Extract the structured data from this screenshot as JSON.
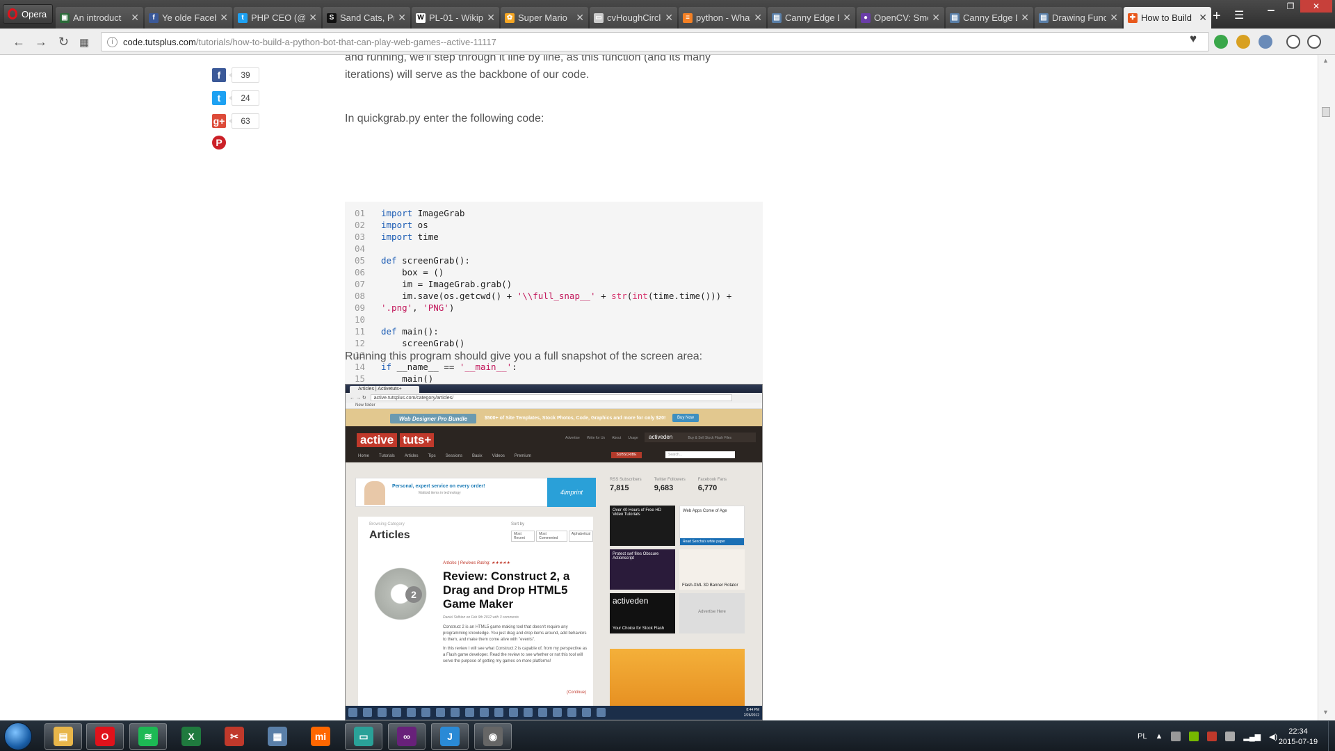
{
  "browser": {
    "menu_label": "Opera",
    "tabs": [
      {
        "title": "An introduct",
        "fav_color": "#2c6b3a",
        "glyph": "▣",
        "active": false
      },
      {
        "title": "Ye olde Faceb",
        "fav_color": "#3b5998",
        "glyph": "f",
        "active": false
      },
      {
        "title": "PHP CEO (@PH",
        "fav_color": "#1da1f2",
        "glyph": "t",
        "active": false
      },
      {
        "title": "Sand Cats, Pri",
        "fav_color": "#111111",
        "glyph": "S",
        "active": false
      },
      {
        "title": "PL-01 - Wikip",
        "fav_color": "#ffffff",
        "glyph": "W",
        "active": false
      },
      {
        "title": "Super Mario",
        "fav_color": "#f5a623",
        "glyph": "✿",
        "active": false
      },
      {
        "title": "cvHoughCircle",
        "fav_color": "#cccccc",
        "glyph": "▭",
        "active": false
      },
      {
        "title": "python - What",
        "fav_color": "#f48024",
        "glyph": "≡",
        "active": false
      },
      {
        "title": "Canny Edge D",
        "fav_color": "#5a7fa8",
        "glyph": "▤",
        "active": false
      },
      {
        "title": "OpenCV: Smo",
        "fav_color": "#6a3da8",
        "glyph": "●",
        "active": false
      },
      {
        "title": "Canny Edge D",
        "fav_color": "#5a7fa8",
        "glyph": "▤",
        "active": false
      },
      {
        "title": "Drawing Func",
        "fav_color": "#5a7fa8",
        "glyph": "▤",
        "active": false
      },
      {
        "title": "How to Build",
        "fav_color": "#e8581c",
        "glyph": "✚",
        "active": true
      }
    ],
    "url_domain": "code.tutsplus.com",
    "url_path": "/tutorials/how-to-build-a-python-bot-that-can-play-web-games--active-11117"
  },
  "share": [
    {
      "network": "facebook",
      "color": "#3b5998",
      "glyph": "f",
      "count": "39"
    },
    {
      "network": "twitter",
      "color": "#1da1f2",
      "glyph": "t",
      "count": "24"
    },
    {
      "network": "google-plus",
      "color": "#dd4b39",
      "glyph": "g+",
      "count": "63"
    },
    {
      "network": "pinterest",
      "color": "#cb2027",
      "glyph": "P",
      "count": ""
    }
  ],
  "article": {
    "para_top": "and running, we'll step through it line by line, as this function (and its many iterations) will serve as the backbone of our code.",
    "para_intro": "In quickgrab.py enter the following code:",
    "para_after": "Running this program should give you a full snapshot of the screen area:"
  },
  "code_lines": [
    {
      "n": "01",
      "html": "<span class=\"kw\">import</span> ImageGrab"
    },
    {
      "n": "02",
      "html": "<span class=\"kw\">import</span> os"
    },
    {
      "n": "03",
      "html": "<span class=\"kw\">import</span> time"
    },
    {
      "n": "04",
      "html": ""
    },
    {
      "n": "05",
      "html": "<span class=\"kw\">def</span> screenGrab():"
    },
    {
      "n": "06",
      "html": "    box = ()"
    },
    {
      "n": "07",
      "html": "    im = ImageGrab.grab()"
    },
    {
      "n": "08",
      "html": "    im.save(os.getcwd() + <span class=\"str\">'\\\\full_snap__'</span> + <span class=\"fn\">str</span>(<span class=\"fn\">int</span>(time.time())) +"
    },
    {
      "n": "09",
      "html": "<span class=\"str\">'.png'</span>, <span class=\"str\">'PNG'</span>)"
    },
    {
      "n": "10",
      "html": ""
    },
    {
      "n": "11",
      "html": "<span class=\"kw\">def</span> main():"
    },
    {
      "n": "12",
      "html": "    screenGrab()"
    },
    {
      "n": "13",
      "html": ""
    },
    {
      "n": "14",
      "html": "<span class=\"kw\">if</span> __name__ == <span class=\"str\">'__main__'</span>:"
    },
    {
      "n": "15",
      "html": "    main()"
    }
  ],
  "screenshot": {
    "tab": "Articles | Activetuts+",
    "url": "active.tutsplus.com/category/articles/",
    "bookmark": "New folder",
    "banner_pill": "Web Designer Pro Bundle",
    "banner_text": "$500+ of Site Templates, Stock Photos, Code, Graphics and more for only $20!",
    "banner_btn": "Buy Now",
    "logo_a": "active",
    "logo_b": "tuts+",
    "nav": [
      "Home",
      "Tutorials",
      "Articles",
      "Tips",
      "Sessions",
      "Basix",
      "Videos",
      "Premium"
    ],
    "toplinks": [
      "Advertise",
      "Write for Us",
      "About",
      "Usage"
    ],
    "activeden": "activeden",
    "activeden_sub": "Buy & Sell Stock Flash Files",
    "subscribe": "SUBSCRIBE",
    "search_placeholder": "Search...",
    "ad_text": "Personal, expert service on every order!",
    "ad_sub": "Mattoid items in technology",
    "ad_brand": "4imprint",
    "stats": [
      {
        "label": "RSS Subscribers",
        "value": "7,815"
      },
      {
        "label": "Twitter Followers",
        "value": "9,683"
      },
      {
        "label": "Facebook Fans",
        "value": "6,770"
      }
    ],
    "category_label": "Browsing Category",
    "category": "Articles",
    "sort_label": "Sort by",
    "sort_options": [
      "Most Recent",
      "Most Commented",
      "Alphabetical"
    ],
    "meta": "Articles | Reviews  Rating: ★★★★★",
    "post_title": "Review: Construct 2, a Drag and Drop HTML5 Game Maker",
    "byline": "Daniel Sidhion on Feb 9th 2012 with 3 comments",
    "body1": "Construct 2 is an HTML5 game making tool that doesn't require any programming knowledge. You just drag and drop items around, add behaviors to them, and make them come alive with \"events\".",
    "body2": "In this review I will see what Construct 2 is capable of, from my perspective as a Flash game developer. Read the review to see whether or not this tool will serve the purpose of getting my games on more platforms!",
    "continue": "(Continue)",
    "box1": "Over 40 Hours of Free HD Video Tutorials",
    "box2": "Web Apps Come of Age",
    "box2_sub": "Read Sencha's white paper",
    "box3": "Protect swf files Obscure Actionscript",
    "box4": "Flash-XML 3D Banner Rotator",
    "box5": "activeden",
    "box5_sub": "Your Choice for Stock Flash",
    "box6": "Advertise Here",
    "clock_time": "8:44 PM",
    "clock_date": "2/26/2012"
  },
  "taskbar": {
    "apps": [
      {
        "name": "explorer",
        "color": "#e8b64a",
        "glyph": "▤",
        "active": true
      },
      {
        "name": "opera",
        "color": "#e0121b",
        "glyph": "O",
        "active": true
      },
      {
        "name": "spotify",
        "color": "#1db954",
        "glyph": "≋",
        "active": true
      },
      {
        "name": "excel",
        "color": "#1f7a3e",
        "glyph": "X",
        "active": false
      },
      {
        "name": "paint-tool",
        "color": "#c0392b",
        "glyph": "✂",
        "active": false
      },
      {
        "name": "network-tool",
        "color": "#5a7fa8",
        "glyph": "▦",
        "active": false
      },
      {
        "name": "mi-app",
        "color": "#ff6700",
        "glyph": "mi",
        "active": false
      },
      {
        "name": "terminal",
        "color": "#2aa198",
        "glyph": "▭",
        "active": true
      },
      {
        "name": "visual-studio",
        "color": "#68217a",
        "glyph": "∞",
        "active": true
      },
      {
        "name": "jetbrains",
        "color": "#2a8ad6",
        "glyph": "J",
        "active": true
      },
      {
        "name": "game-pad",
        "color": "#666666",
        "glyph": "◉",
        "active": true
      }
    ],
    "lang": "PL",
    "time": "22:34",
    "date": "2015-07-19"
  }
}
